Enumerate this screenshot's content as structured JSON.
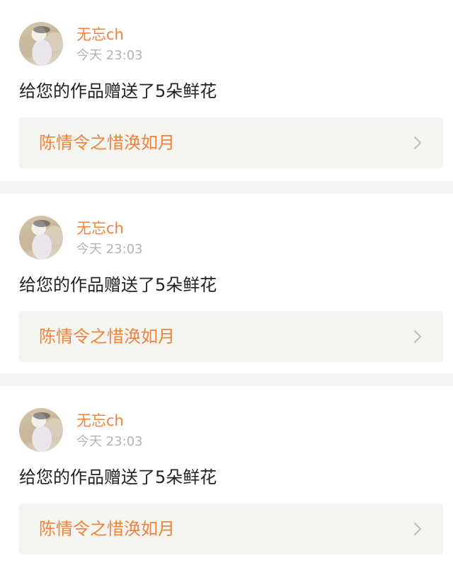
{
  "colors": {
    "accent": "#f0823f",
    "message_text": "#222222",
    "timestamp": "#b4b4b4",
    "link_background": "#f5f5ef",
    "separator": "#f4f4f4"
  },
  "notifications": [
    {
      "username": "无忘ch",
      "time": "今天 23:03",
      "message": "给您的作品赠送了5朵鲜花",
      "work_title": "陈情令之惜涣如月",
      "link_icon": "chevron-right-icon"
    },
    {
      "username": "无忘ch",
      "time": "今天 23:03",
      "message": "给您的作品赠送了5朵鲜花",
      "work_title": "陈情令之惜涣如月",
      "link_icon": "chevron-right-icon"
    },
    {
      "username": "无忘ch",
      "time": "今天 23:03",
      "message": "给您的作品赠送了5朵鲜花",
      "work_title": "陈情令之惜涣如月",
      "link_icon": "chevron-right-icon"
    }
  ]
}
